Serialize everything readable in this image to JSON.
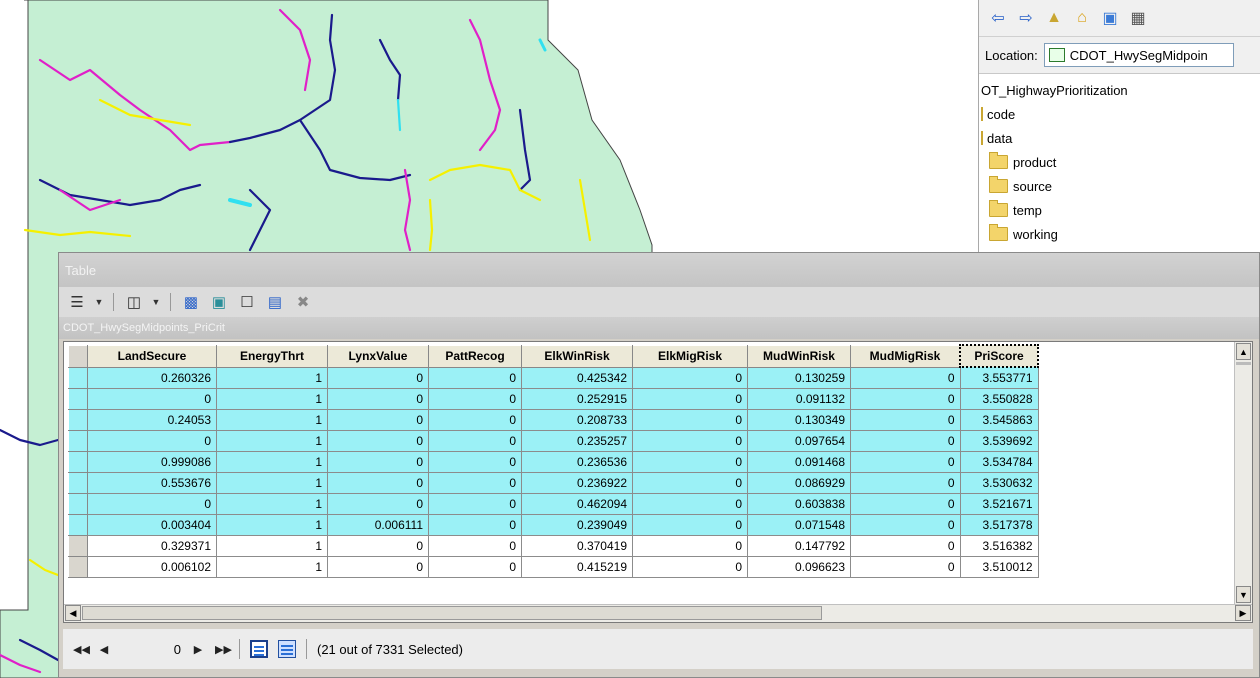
{
  "catalog": {
    "location_label": "Location:",
    "location_value": "CDOT_HwySegMidpoin",
    "tree": [
      {
        "label": "OT_HighwayPrioritization",
        "depth": 0,
        "folder": false
      },
      {
        "label": "code",
        "depth": 0,
        "folder": false
      },
      {
        "label": "data",
        "depth": 0,
        "folder": false
      },
      {
        "label": "product",
        "depth": 1,
        "folder": true
      },
      {
        "label": "source",
        "depth": 1,
        "folder": true
      },
      {
        "label": "temp",
        "depth": 1,
        "folder": true
      },
      {
        "label": "working",
        "depth": 1,
        "folder": true
      }
    ]
  },
  "table_window": {
    "title": "Table",
    "table_name": "CDOT_HwySegMidpoints_PriCrit",
    "columns": [
      "LandSecure",
      "EnergyThrt",
      "LynxValue",
      "PattRecog",
      "ElkWinRisk",
      "ElkMigRisk",
      "MudWinRisk",
      "MudMigRisk",
      "PriScore"
    ],
    "sorted_column": "PriScore",
    "rows": [
      {
        "selected": true,
        "cells": [
          "0.260326",
          "1",
          "0",
          "0",
          "0.425342",
          "0",
          "0.130259",
          "0",
          "3.553771"
        ]
      },
      {
        "selected": true,
        "cells": [
          "0",
          "1",
          "0",
          "0",
          "0.252915",
          "0",
          "0.091132",
          "0",
          "3.550828"
        ]
      },
      {
        "selected": true,
        "cells": [
          "0.24053",
          "1",
          "0",
          "0",
          "0.208733",
          "0",
          "0.130349",
          "0",
          "3.545863"
        ]
      },
      {
        "selected": true,
        "cells": [
          "0",
          "1",
          "0",
          "0",
          "0.235257",
          "0",
          "0.097654",
          "0",
          "3.539692"
        ]
      },
      {
        "selected": true,
        "cells": [
          "0.999086",
          "1",
          "0",
          "0",
          "0.236536",
          "0",
          "0.091468",
          "0",
          "3.534784"
        ]
      },
      {
        "selected": true,
        "cells": [
          "0.553676",
          "1",
          "0",
          "0",
          "0.236922",
          "0",
          "0.086929",
          "0",
          "3.530632"
        ]
      },
      {
        "selected": true,
        "cells": [
          "0",
          "1",
          "0",
          "0",
          "0.462094",
          "0",
          "0.603838",
          "0",
          "3.521671"
        ]
      },
      {
        "selected": true,
        "cells": [
          "0.003404",
          "1",
          "0.006111",
          "0",
          "0.239049",
          "0",
          "0.071548",
          "0",
          "3.517378"
        ]
      },
      {
        "selected": false,
        "cells": [
          "0.329371",
          "1",
          "0",
          "0",
          "0.370419",
          "0",
          "0.147792",
          "0",
          "3.516382"
        ]
      },
      {
        "selected": false,
        "cells": [
          "0.006102",
          "1",
          "0",
          "0",
          "0.415219",
          "0",
          "0.096623",
          "0",
          "3.510012"
        ]
      }
    ],
    "nav": {
      "current_record": "0",
      "selection_status": "(21 out of 7331 Selected)"
    }
  },
  "colors": {
    "map_land": "#c5efd3",
    "selected_row": "#9bf1f6",
    "road_yellow": "#f5f000",
    "road_magenta": "#e020c8",
    "road_navy": "#1a1a8c",
    "road_cyan": "#30e0f0"
  },
  "icons": [
    "back-arrow-icon",
    "forward-arrow-icon",
    "up-folder-icon",
    "home-icon",
    "connect-folder-icon",
    "grid-view-icon",
    "table-options-icon",
    "related-tables-icon",
    "select-by-attributes-icon",
    "switch-selection-icon",
    "clear-selection-icon",
    "zoom-to-selected-icon",
    "delete-selected-icon",
    "folder-icon"
  ]
}
